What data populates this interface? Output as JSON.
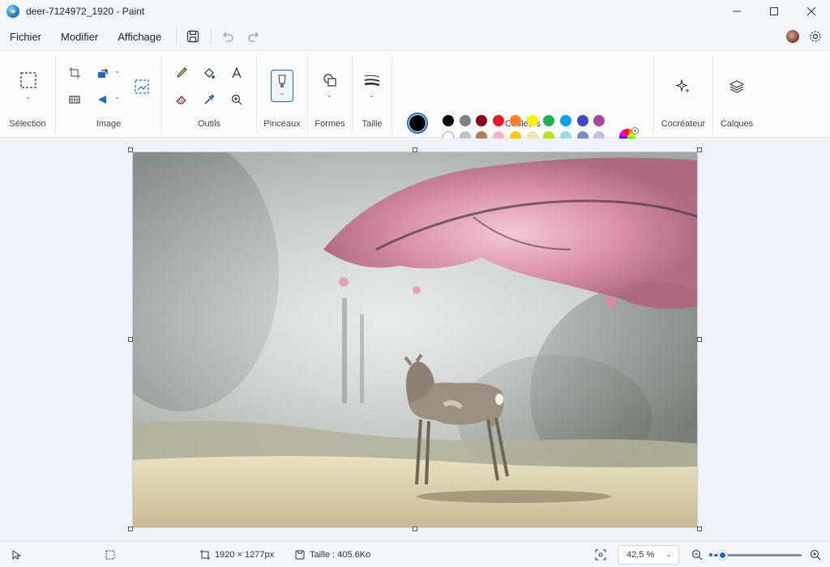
{
  "window": {
    "title": "deer-7124972_1920 - Paint",
    "minimize_icon": "minimize-icon",
    "maximize_icon": "maximize-icon",
    "close_icon": "close-icon"
  },
  "menu": {
    "items": [
      "Fichier",
      "Modifier",
      "Affichage"
    ],
    "quick_actions": [
      "save-icon",
      "undo-icon",
      "redo-icon"
    ]
  },
  "ribbon": {
    "groups": {
      "selection": "Sélection",
      "image": "Image",
      "tools": "Outils",
      "brushes": "Pinceaux",
      "shapes": "Formes",
      "size": "Taille",
      "colors": "Couleurs",
      "cocreator": "Cocréateur",
      "layers": "Calques"
    },
    "palette": {
      "row1": [
        "#000000",
        "#7f7f7f",
        "#880015",
        "#ed1c24",
        "#ff7f27",
        "#fff200",
        "#22b14c",
        "#00a2e8",
        "#3f48cc",
        "#a349a4"
      ],
      "row2": [
        "#ffffff",
        "#c3c3c3",
        "#b97a57",
        "#ffaec9",
        "#ffc90e",
        "#efe4b0",
        "#b5e61d",
        "#99d9ea",
        "#7092be",
        "#c8bfe7"
      ],
      "row3_empty_count": 10
    },
    "primary_color": "#000000",
    "secondary_color": "#ffffff"
  },
  "canvas": {
    "image_description": "deer under cherry blossom tree"
  },
  "status": {
    "dimensions": "1920 × 1277px",
    "file_size": "Taille : 405.6Ko",
    "zoom": "42,5 %",
    "zoom_level": 0.09
  }
}
